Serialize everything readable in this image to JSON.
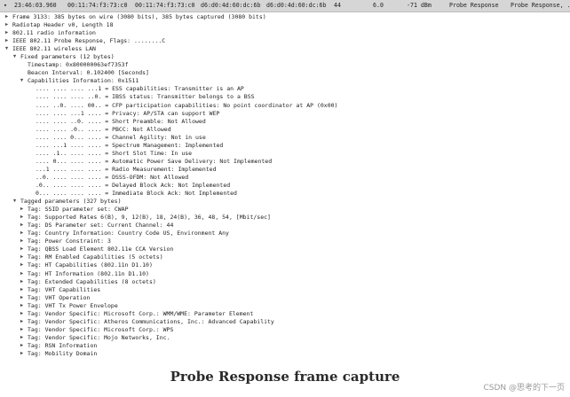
{
  "packet_row": {
    "time": "23:46:03.960",
    "source": "00:11:74:f3:73:c0",
    "destination": "00:11:74:f3:73:c0",
    "bssid": "d6:d0:4d:60:dc:6b",
    "bssid2": "d6:d0:4d:60:dc:6b",
    "channel": "44",
    "rate": "6.0",
    "signal": "-71 dBm",
    "type": "Probe Response",
    "info": "Probe Response, ..."
  },
  "tree": [
    {
      "indent": 0,
      "toggle": "collapsed",
      "text": "Frame 3133: 385 bytes on wire (3080 bits), 385 bytes captured (3080 bits)"
    },
    {
      "indent": 0,
      "toggle": "collapsed",
      "text": "Radiotap Header v0, Length 18"
    },
    {
      "indent": 0,
      "toggle": "collapsed",
      "text": "802.11 radio information"
    },
    {
      "indent": 0,
      "toggle": "collapsed",
      "text": "IEEE 802.11 Probe Response, Flags: ........C"
    },
    {
      "indent": 0,
      "toggle": "expanded",
      "text": "IEEE 802.11 wireless LAN"
    },
    {
      "indent": 1,
      "toggle": "expanded",
      "text": "Fixed parameters (12 bytes)"
    },
    {
      "indent": 2,
      "toggle": "none",
      "text": "Timestamp: 0x800000063ef7353f"
    },
    {
      "indent": 2,
      "toggle": "none",
      "text": "Beacon Interval: 0.102400 [Seconds]"
    },
    {
      "indent": 2,
      "toggle": "expanded",
      "text": "Capabilities Information: 0x1511"
    },
    {
      "indent": 3,
      "toggle": "none",
      "text": ".... .... .... ...1 = ESS capabilities: Transmitter is an AP"
    },
    {
      "indent": 3,
      "toggle": "none",
      "text": ".... .... .... ..0. = IBSS status: Transmitter belongs to a BSS"
    },
    {
      "indent": 3,
      "toggle": "none",
      "text": ".... ..0. .... 00.. = CFP participation capabilities: No point coordinator at AP (0x00)"
    },
    {
      "indent": 3,
      "toggle": "none",
      "text": ".... .... ...1 .... = Privacy: AP/STA can support WEP"
    },
    {
      "indent": 3,
      "toggle": "none",
      "text": ".... .... ..0. .... = Short Preamble: Not Allowed"
    },
    {
      "indent": 3,
      "toggle": "none",
      "text": ".... .... .0.. .... = PBCC: Not Allowed"
    },
    {
      "indent": 3,
      "toggle": "none",
      "text": ".... .... 0... .... = Channel Agility: Not in use"
    },
    {
      "indent": 3,
      "toggle": "none",
      "text": ".... ...1 .... .... = Spectrum Management: Implemented"
    },
    {
      "indent": 3,
      "toggle": "none",
      "text": ".... .1.. .... .... = Short Slot Time: In use"
    },
    {
      "indent": 3,
      "toggle": "none",
      "text": ".... 0... .... .... = Automatic Power Save Delivery: Not Implemented"
    },
    {
      "indent": 3,
      "toggle": "none",
      "text": "...1 .... .... .... = Radio Measurement: Implemented"
    },
    {
      "indent": 3,
      "toggle": "none",
      "text": "..0. .... .... .... = DSSS-OFDM: Not Allowed"
    },
    {
      "indent": 3,
      "toggle": "none",
      "text": ".0.. .... .... .... = Delayed Block Ack: Not Implemented"
    },
    {
      "indent": 3,
      "toggle": "none",
      "text": "0... .... .... .... = Immediate Block Ack: Not Implemented"
    },
    {
      "indent": 1,
      "toggle": "expanded",
      "text": "Tagged parameters (327 bytes)"
    },
    {
      "indent": 2,
      "toggle": "collapsed",
      "text": "Tag: SSID parameter set: CWAP"
    },
    {
      "indent": 2,
      "toggle": "collapsed",
      "text": "Tag: Supported Rates 6(B), 9, 12(B), 18, 24(B), 36, 48, 54, [Mbit/sec]"
    },
    {
      "indent": 2,
      "toggle": "collapsed",
      "text": "Tag: DS Parameter set: Current Channel: 44"
    },
    {
      "indent": 2,
      "toggle": "collapsed",
      "text": "Tag: Country Information: Country Code US, Environment Any"
    },
    {
      "indent": 2,
      "toggle": "collapsed",
      "text": "Tag: Power Constraint: 3"
    },
    {
      "indent": 2,
      "toggle": "collapsed",
      "text": "Tag: QBSS Load Element 802.11e CCA Version"
    },
    {
      "indent": 2,
      "toggle": "collapsed",
      "text": "Tag: RM Enabled Capabilities (5 octets)"
    },
    {
      "indent": 2,
      "toggle": "collapsed",
      "text": "Tag: HT Capabilities (802.11n D1.10)"
    },
    {
      "indent": 2,
      "toggle": "collapsed",
      "text": "Tag: HT Information (802.11n D1.10)"
    },
    {
      "indent": 2,
      "toggle": "collapsed",
      "text": "Tag: Extended Capabilities (8 octets)"
    },
    {
      "indent": 2,
      "toggle": "collapsed",
      "text": "Tag: VHT Capabilities"
    },
    {
      "indent": 2,
      "toggle": "collapsed",
      "text": "Tag: VHT Operation"
    },
    {
      "indent": 2,
      "toggle": "collapsed",
      "text": "Tag: VHT Tx Power Envelope"
    },
    {
      "indent": 2,
      "toggle": "collapsed",
      "text": "Tag: Vendor Specific: Microsoft Corp.: WMM/WME: Parameter Element"
    },
    {
      "indent": 2,
      "toggle": "collapsed",
      "text": "Tag: Vendor Specific: Atheros Communications, Inc.: Advanced Capability"
    },
    {
      "indent": 2,
      "toggle": "collapsed",
      "text": "Tag: Vendor Specific: Microsoft Corp.: WPS"
    },
    {
      "indent": 2,
      "toggle": "collapsed",
      "text": "Tag: Vendor Specific: Mojo Networks, Inc."
    },
    {
      "indent": 2,
      "toggle": "collapsed",
      "text": "Tag: RSN Information"
    },
    {
      "indent": 2,
      "toggle": "collapsed",
      "text": "Tag: Mobility Domain"
    }
  ],
  "caption": "Probe Response frame capture",
  "watermark": "CSDN @思考的下一页",
  "colors": {
    "topbar": "#d6d6d6",
    "text": "#1e1e1e",
    "toggle": "#555555"
  }
}
